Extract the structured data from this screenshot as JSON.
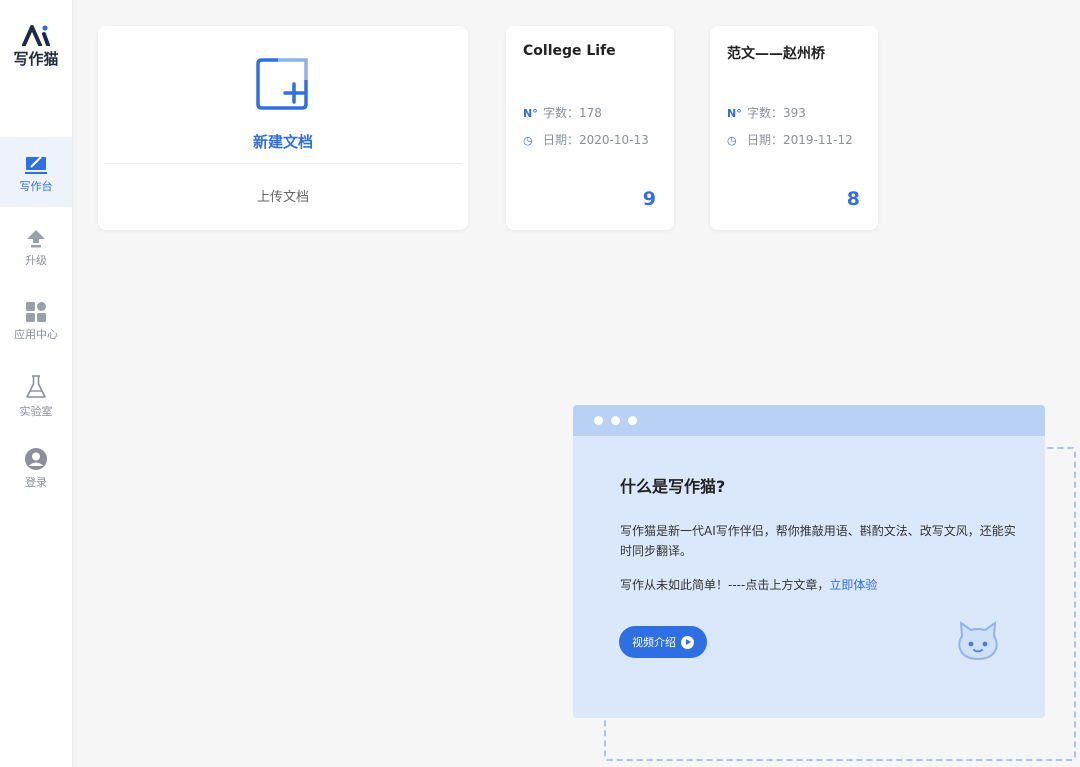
{
  "app": {
    "logo_text": "写作猫"
  },
  "sidebar": {
    "items": [
      {
        "label": "写作台",
        "icon": "write-desk-icon",
        "active": true
      },
      {
        "label": "升级",
        "icon": "upgrade-arrow-icon"
      },
      {
        "label": "应用中心",
        "icon": "app-grid-icon"
      },
      {
        "label": "实验室",
        "icon": "lab-flask-icon"
      },
      {
        "label": "登录",
        "icon": "user-avatar-icon"
      }
    ]
  },
  "new_doc": {
    "label": "新建文档",
    "upload_label": "上传文档"
  },
  "documents": [
    {
      "title": "College Life",
      "word_count": "字数：178",
      "date": "日期：2020-10-13",
      "count": "9"
    },
    {
      "title": "范文——赵州桥",
      "word_count": "字数：393",
      "date": "日期：2019-11-12",
      "count": "8"
    }
  ],
  "intro": {
    "title": "什么是写作猫?",
    "paragraph1": "写作猫是新一代AI写作伴侣，帮你推敲用语、斟酌文法、改写文风，还能实时同步翻译。",
    "paragraph2_prefix": "写作从未如此简单！----点击上方文章，",
    "paragraph2_link": "立即体验",
    "video_button": "视频介绍"
  },
  "colors": {
    "accent": "#2f6fe4",
    "panel_bg": "#dbe7fb",
    "panel_bar": "#b9d1f5",
    "page_bg": "#f6f6f6"
  }
}
